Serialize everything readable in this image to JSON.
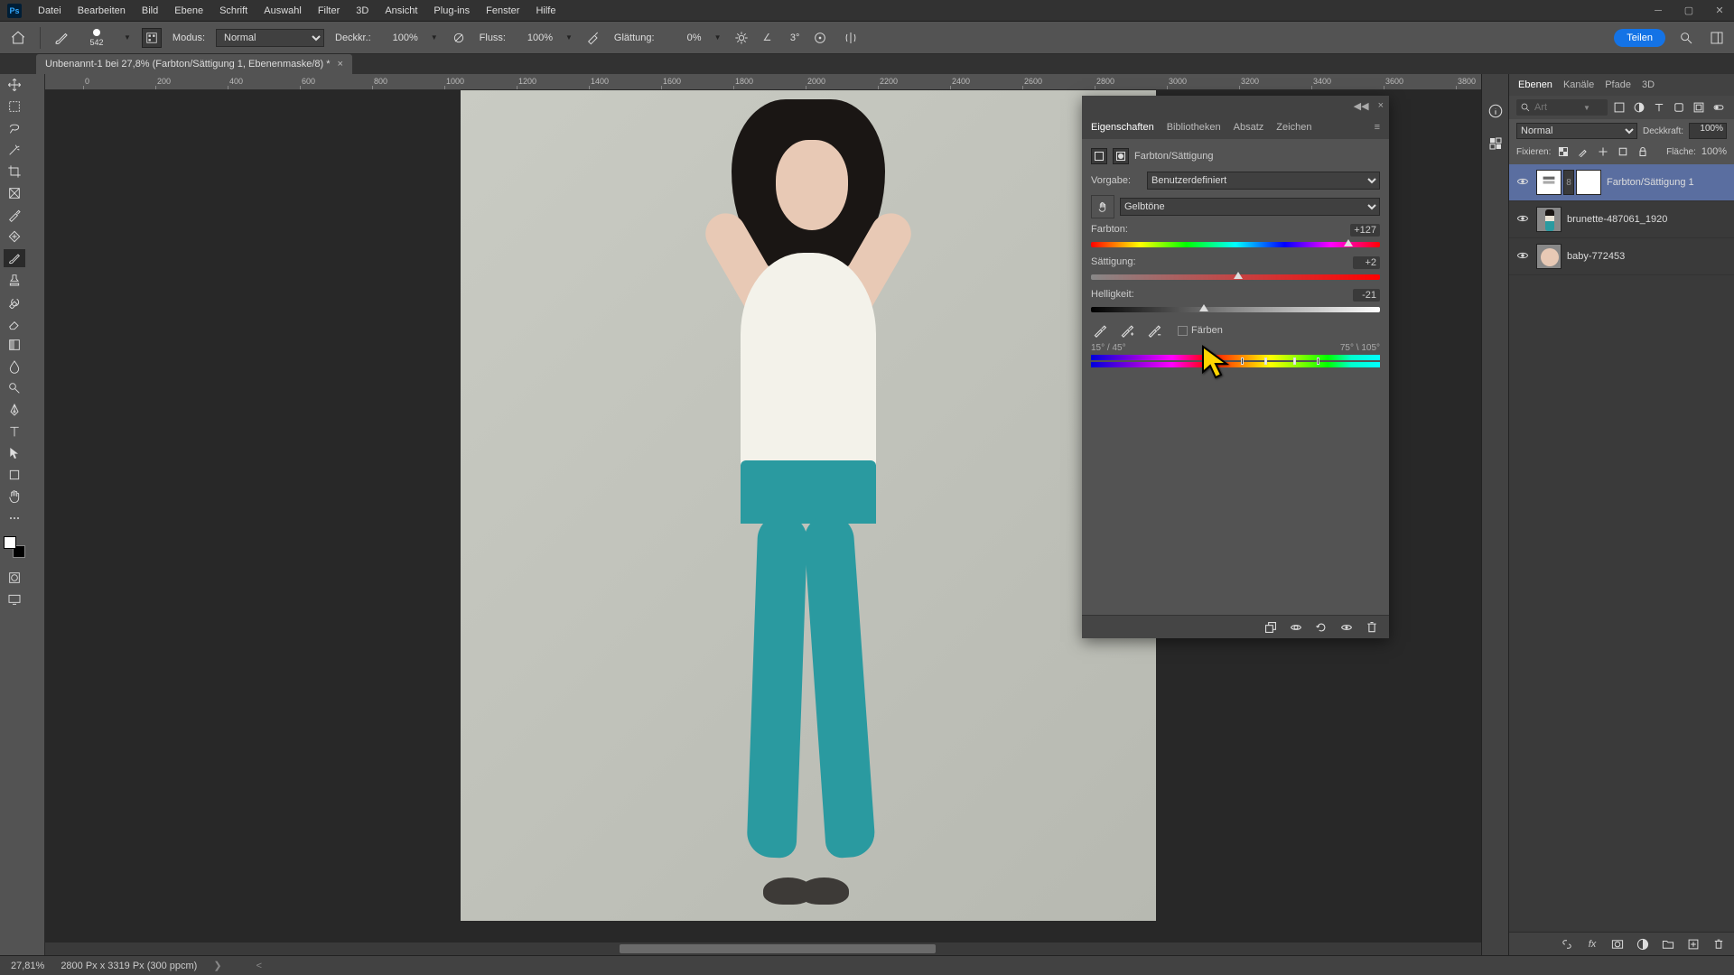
{
  "menus": [
    "Datei",
    "Bearbeiten",
    "Bild",
    "Ebene",
    "Schrift",
    "Auswahl",
    "Filter",
    "3D",
    "Ansicht",
    "Plug-ins",
    "Fenster",
    "Hilfe"
  ],
  "options": {
    "brush_size": "542",
    "mode_label": "Modus:",
    "mode_value": "Normal",
    "opacity_label": "Deckkr.:",
    "opacity_value": "100%",
    "flow_label": "Fluss:",
    "flow_value": "100%",
    "smoothing_label": "Glättung:",
    "smoothing_value": "0%",
    "angle_icon": "∠",
    "angle_value": "3°",
    "share": "Teilen"
  },
  "doc_tab": {
    "title": "Unbenannt-1 bei 27,8% (Farbton/Sättigung 1, Ebenenmaske/8) *"
  },
  "ruler_marks": [
    "0",
    "200",
    "400",
    "600",
    "800",
    "1000",
    "1200",
    "1400",
    "1600",
    "1800",
    "2000",
    "2200",
    "2400",
    "2600",
    "2800",
    "3000",
    "3200",
    "3400",
    "3600",
    "3800"
  ],
  "properties": {
    "tabs": [
      "Eigenschaften",
      "Bibliotheken",
      "Absatz",
      "Zeichen"
    ],
    "adj_title": "Farbton/Sättigung",
    "preset_label": "Vorgabe:",
    "preset_value": "Benutzerdefiniert",
    "channel_value": "Gelbtöne",
    "hue_label": "Farbton:",
    "hue_value": "+127",
    "sat_label": "Sättigung:",
    "sat_value": "+2",
    "lig_label": "Helligkeit:",
    "lig_value": "-21",
    "colorize_label": "Färben",
    "range_left": "15° / 45°",
    "range_right": "75° \\ 105°"
  },
  "layers_panel": {
    "tabs": [
      "Ebenen",
      "Kanäle",
      "Pfade",
      "3D"
    ],
    "search_placeholder": "Art",
    "blend_mode": "Normal",
    "opacity_label": "Deckkraft:",
    "opacity_value": "100%",
    "lock_label": "Fixieren:",
    "fill_label": "Fläche:",
    "fill_value": "100%",
    "layers": [
      {
        "name": "Farbton/Sättigung 1",
        "type": "adjustment",
        "selected": true
      },
      {
        "name": "brunette-487061_1920",
        "type": "image1",
        "selected": false
      },
      {
        "name": "baby-772453",
        "type": "image2",
        "selected": false
      }
    ]
  },
  "status": {
    "zoom": "27,81%",
    "doc_size": "2800 Px x 3319 Px (300 ppcm)"
  }
}
